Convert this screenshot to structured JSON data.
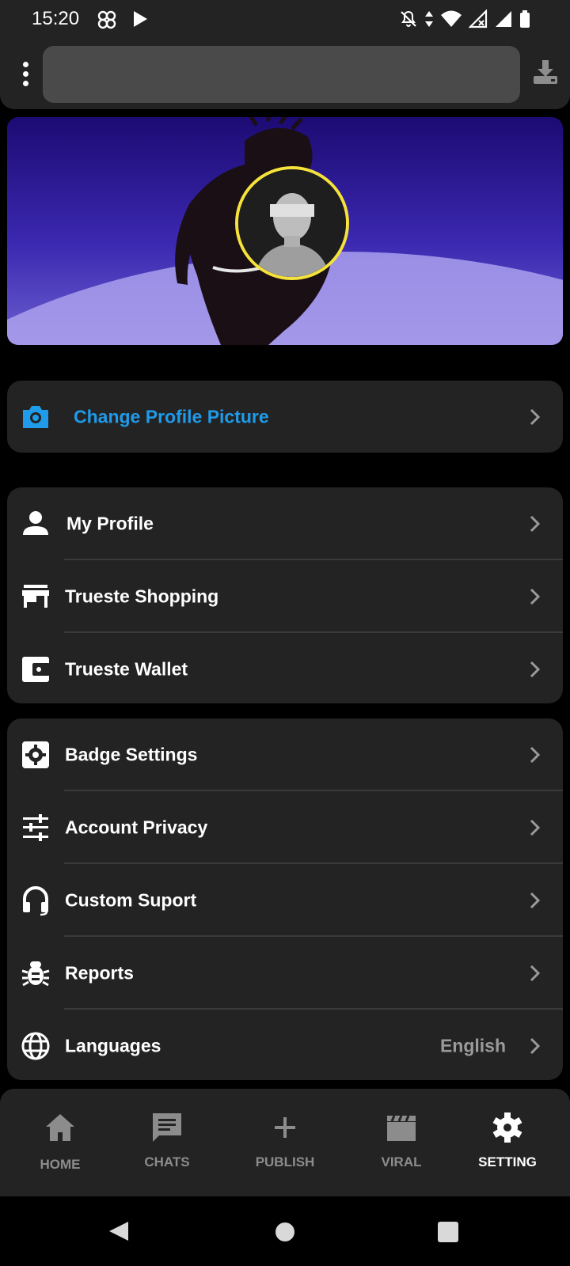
{
  "status_bar": {
    "time": "15:20",
    "left_icons": [
      "pinwheel-icon",
      "play-icon"
    ],
    "right_icons": [
      "notifications-off-icon",
      "data-arrows-icon",
      "wifi-icon",
      "signal-x-icon",
      "signal-icon",
      "battery-icon"
    ]
  },
  "top_bar": {
    "search_placeholder": "",
    "menu_icon": "more-vertical-icon",
    "download_icon": "download-icon"
  },
  "profile": {
    "avatar_border_color": "#f5e23a"
  },
  "change_picture": {
    "label": "Change Profile Picture",
    "color": "#1f9bea"
  },
  "account_group": [
    {
      "label": "My Profile",
      "icon": "person-icon"
    },
    {
      "label": "Trueste Shopping",
      "icon": "store-icon"
    },
    {
      "label": "Trueste Wallet",
      "icon": "wallet-icon"
    }
  ],
  "settings_group": [
    {
      "label": "Badge Settings",
      "icon": "badge-gear-icon"
    },
    {
      "label": "Account Privacy",
      "icon": "sliders-icon"
    },
    {
      "label": "Custom Suport",
      "icon": "headset-icon"
    },
    {
      "label": "Reports",
      "icon": "bug-icon"
    },
    {
      "label": "Languages",
      "icon": "globe-icon",
      "value": "English"
    }
  ],
  "bottom_nav": [
    {
      "label": "HOME",
      "icon": "home-icon",
      "active": false
    },
    {
      "label": "CHATS",
      "icon": "chat-icon",
      "active": false
    },
    {
      "label": "PUBLISH",
      "icon": "plus-icon",
      "active": false
    },
    {
      "label": "VIRAL",
      "icon": "clapperboard-icon",
      "active": false
    },
    {
      "label": "SETTING",
      "icon": "settings-icon",
      "active": true
    }
  ]
}
